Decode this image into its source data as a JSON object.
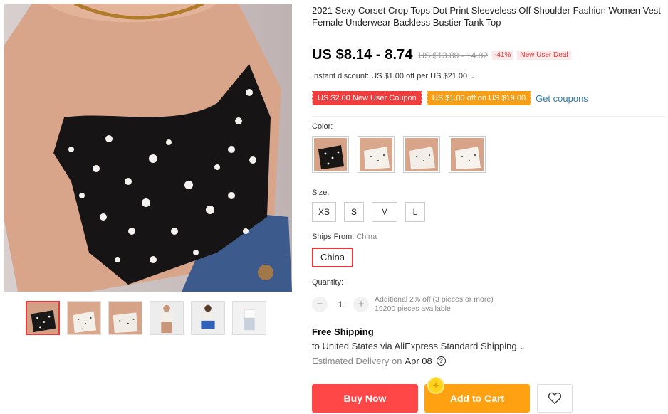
{
  "product": {
    "title": "2021 Sexy Corset Crop Tops Dot Print Sleeveless Off Shoulder Fashion Women Vest Female Underwear Backless Bustier Tank Top",
    "price": "US $8.14 - 8.74",
    "original_price": "US $13.80 - 14.82",
    "discount": "-41%",
    "deal_badge": "New User Deal",
    "instant_discount": "Instant discount: US $1.00 off per US $21.00",
    "coupons": [
      "US $2.00 New User Coupon",
      "US $1.00 off on US $19.00"
    ],
    "get_coupons": "Get coupons"
  },
  "options": {
    "color_label": "Color:",
    "colors": [
      "black-dot",
      "white-dot",
      "white-dot",
      "white-dot"
    ],
    "size_label": "Size:",
    "sizes": [
      "XS",
      "S",
      "M",
      "L"
    ],
    "ships_from_label": "Ships From:",
    "ships_from_value": "China",
    "ships_from_selected": "China"
  },
  "quantity": {
    "label": "Quantity:",
    "minus": "−",
    "value": "1",
    "plus": "+",
    "additional": "Additional 2% off (3 pieces or more)",
    "available": "19200 pieces available"
  },
  "shipping": {
    "title": "Free Shipping",
    "to": "to United States via AliExpress Standard Shipping",
    "estimated": "Estimated Delivery on",
    "date": "Apr 08"
  },
  "actions": {
    "buy_now": "Buy Now",
    "add_to_cart": "Add to Cart"
  },
  "colors": {
    "accent": "#ff4747",
    "cart": "#ffa111",
    "link": "#2e7db3"
  }
}
